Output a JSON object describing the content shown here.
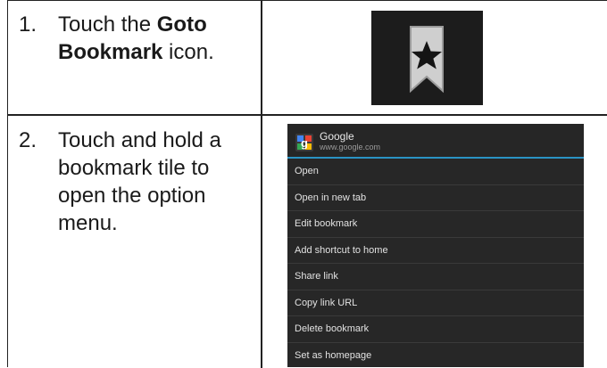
{
  "steps": [
    {
      "number": "1.",
      "text_before": "Touch the ",
      "bold": "Goto Bookmark",
      "text_after": " icon."
    },
    {
      "number": "2.",
      "text": "Touch and hold a bookmark tile to open the option menu."
    }
  ],
  "bookmark_icon": {
    "name": "goto-bookmark-icon"
  },
  "menu": {
    "title": "Google",
    "url": "www.google.com",
    "items": [
      "Open",
      "Open in new tab",
      "Edit bookmark",
      "Add shortcut to home",
      "Share link",
      "Copy link URL",
      "Delete bookmark",
      "Set as homepage"
    ]
  },
  "colors": {
    "accent_line": "#2a93c4",
    "menu_background": "#272727"
  }
}
